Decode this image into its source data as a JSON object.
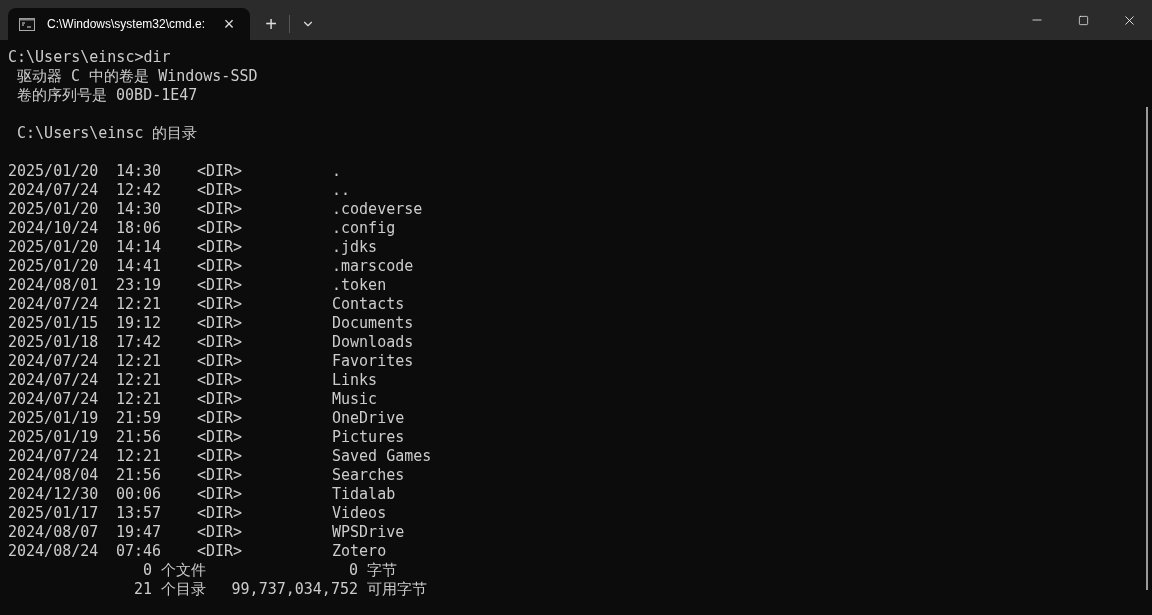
{
  "tab": {
    "title": "C:\\Windows\\system32\\cmd.e:",
    "close": "×",
    "selected": true
  },
  "new_tab": "+",
  "header_lines": [
    {
      "text": "C:\\Users\\einsc>dir"
    },
    {
      "text": " 驱动器 C 中的卷是 Windows-SSD"
    },
    {
      "text": " 卷的序列号是 00BD-1E47"
    }
  ],
  "directory_heading": " C:\\Users\\einsc 的目录",
  "entries": [
    {
      "date": "2025/01/20",
      "time": "14:30",
      "type": "<DIR>",
      "name": "."
    },
    {
      "date": "2024/07/24",
      "time": "12:42",
      "type": "<DIR>",
      "name": ".."
    },
    {
      "date": "2025/01/20",
      "time": "14:30",
      "type": "<DIR>",
      "name": ".codeverse"
    },
    {
      "date": "2024/10/24",
      "time": "18:06",
      "type": "<DIR>",
      "name": ".config"
    },
    {
      "date": "2025/01/20",
      "time": "14:14",
      "type": "<DIR>",
      "name": ".jdks"
    },
    {
      "date": "2025/01/20",
      "time": "14:41",
      "type": "<DIR>",
      "name": ".marscode"
    },
    {
      "date": "2024/08/01",
      "time": "23:19",
      "type": "<DIR>",
      "name": ".token"
    },
    {
      "date": "2024/07/24",
      "time": "12:21",
      "type": "<DIR>",
      "name": "Contacts"
    },
    {
      "date": "2025/01/15",
      "time": "19:12",
      "type": "<DIR>",
      "name": "Documents"
    },
    {
      "date": "2025/01/18",
      "time": "17:42",
      "type": "<DIR>",
      "name": "Downloads"
    },
    {
      "date": "2024/07/24",
      "time": "12:21",
      "type": "<DIR>",
      "name": "Favorites"
    },
    {
      "date": "2024/07/24",
      "time": "12:21",
      "type": "<DIR>",
      "name": "Links"
    },
    {
      "date": "2024/07/24",
      "time": "12:21",
      "type": "<DIR>",
      "name": "Music"
    },
    {
      "date": "2025/01/19",
      "time": "21:59",
      "type": "<DIR>",
      "name": "OneDrive"
    },
    {
      "date": "2025/01/19",
      "time": "21:56",
      "type": "<DIR>",
      "name": "Pictures"
    },
    {
      "date": "2024/07/24",
      "time": "12:21",
      "type": "<DIR>",
      "name": "Saved Games"
    },
    {
      "date": "2024/08/04",
      "time": "21:56",
      "type": "<DIR>",
      "name": "Searches"
    },
    {
      "date": "2024/12/30",
      "time": "00:06",
      "type": "<DIR>",
      "name": "Tidalab"
    },
    {
      "date": "2025/01/17",
      "time": "13:57",
      "type": "<DIR>",
      "name": "Videos"
    },
    {
      "date": "2024/08/07",
      "time": "19:47",
      "type": "<DIR>",
      "name": "WPSDrive"
    },
    {
      "date": "2024/08/24",
      "time": "07:46",
      "type": "<DIR>",
      "name": "Zotero"
    }
  ],
  "summary": [
    {
      "count": "0",
      "unit": "个文件",
      "bytes": "0",
      "bytes_unit": "字节"
    },
    {
      "count": "21",
      "unit": "个目录",
      "bytes": "99,737,034,752",
      "bytes_unit": "可用字节"
    }
  ]
}
